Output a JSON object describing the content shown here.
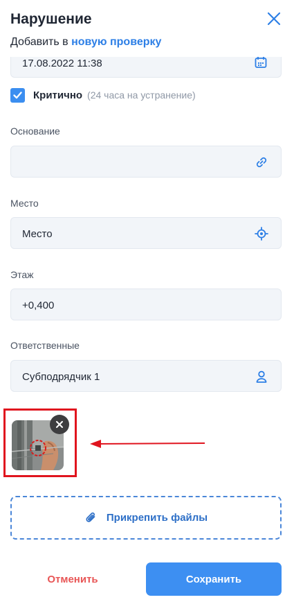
{
  "header": {
    "title": "Нарушение",
    "subtitle_prefix": "Добавить в ",
    "subtitle_link": "новую проверку"
  },
  "date_field": {
    "value": "17.08.2022 11:38",
    "icon": "calendar-icon"
  },
  "critical": {
    "checked": true,
    "label": "Критично",
    "hint": "(24 часа на устранение)"
  },
  "fields": {
    "basis": {
      "label": "Основание",
      "value": "",
      "icon": "link-icon"
    },
    "place": {
      "label": "Место",
      "value": "Место",
      "icon": "location-target-icon"
    },
    "floor": {
      "label": "Этаж",
      "value": "+0,400"
    },
    "responsible": {
      "label": "Ответственные",
      "value": "Субподрядчик 1",
      "icon": "user-icon"
    }
  },
  "attachment": {
    "thumbnail": "photo-thumbnail",
    "remove_icon": "close-icon"
  },
  "attach_button": {
    "label": "Прикрепить файлы",
    "icon": "paperclip-icon"
  },
  "actions": {
    "cancel": "Отменить",
    "save": "Сохранить"
  },
  "colors": {
    "accent": "#3d8ff2",
    "link": "#2d7fe6",
    "danger": "#e85656",
    "highlight": "#e0141e"
  }
}
